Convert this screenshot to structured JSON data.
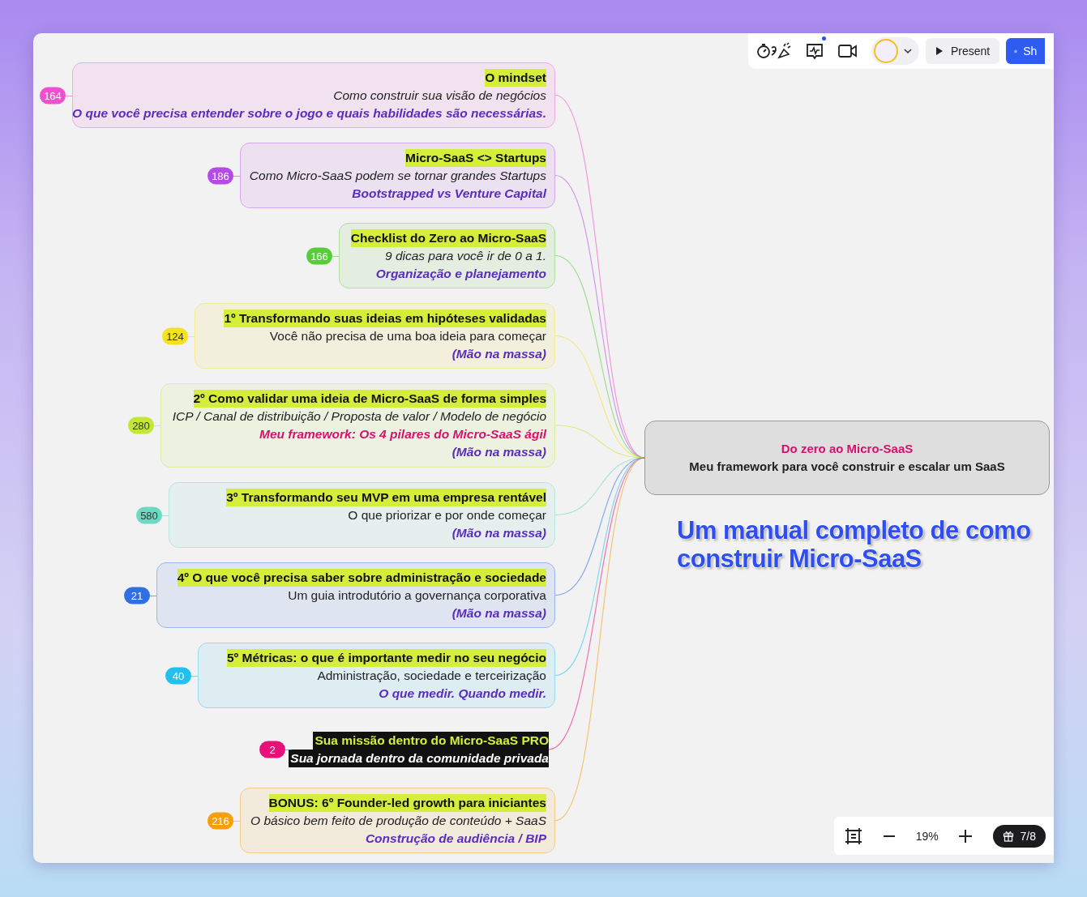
{
  "toolbar": {
    "present_label": "Present",
    "share_label": "Sh",
    "notification_dot": true
  },
  "nodes": [
    {
      "kind": "card",
      "count": "164",
      "color": "#f14fd0",
      "lines": [
        {
          "kind": "title",
          "text": "O mindset"
        },
        {
          "kind": "italic",
          "text": "Como construir sua visão de negócios"
        },
        {
          "kind": "note",
          "text": "O que você precisa entender sobre o jogo e quais habilidades são necessárias."
        }
      ]
    },
    {
      "kind": "card",
      "count": "186",
      "color": "#b54ae6",
      "lines": [
        {
          "kind": "title",
          "text": "Micro-SaaS <> Startups"
        },
        {
          "kind": "italic",
          "text": "Como Micro-SaaS podem se tornar grandes Startups"
        },
        {
          "kind": "note",
          "text": "Bootstrapped vs Venture Capital"
        }
      ]
    },
    {
      "kind": "card",
      "count": "166",
      "color": "#57cc3a",
      "lines": [
        {
          "kind": "title",
          "text": "Checklist do Zero ao Micro-SaaS"
        },
        {
          "kind": "italic",
          "text": "9 dicas para você ir de 0 a 1."
        },
        {
          "kind": "note",
          "text": "Organização e planejamento"
        }
      ]
    },
    {
      "kind": "card",
      "count": "124",
      "color": "#f4e21c",
      "lines": [
        {
          "kind": "title",
          "text": "1º Transformando suas ideias em hipóteses validadas"
        },
        {
          "kind": "plain",
          "text": "Você não precisa de uma boa ideia para começar"
        },
        {
          "kind": "note",
          "text": "(Mão na massa)"
        }
      ]
    },
    {
      "kind": "card",
      "count": "280",
      "color": "#c4e634",
      "lines": [
        {
          "kind": "title",
          "text": "2º Como validar uma ideia de Micro-SaaS de forma simples"
        },
        {
          "kind": "italic",
          "text": "ICP / Canal de distribuição / Proposta de valor / Modelo de negócio"
        },
        {
          "kind": "framework",
          "text": "Meu framework: Os 4 pilares do Micro-SaaS ágil"
        },
        {
          "kind": "note",
          "text": "(Mão na massa)"
        }
      ]
    },
    {
      "kind": "card",
      "count": "580",
      "color": "#6fd8c2",
      "lines": [
        {
          "kind": "title",
          "text": "3º Transformando seu MVP em uma empresa rentável"
        },
        {
          "kind": "plain",
          "text": "O que priorizar e por onde começar"
        },
        {
          "kind": "note",
          "text": "(Mão na massa)"
        }
      ]
    },
    {
      "kind": "card",
      "count": "21",
      "color": "#2f6fe2",
      "lines": [
        {
          "kind": "title",
          "text": "4º O que você precisa saber sobre administração e sociedade"
        },
        {
          "kind": "plain",
          "text": "Um guia introdutório a governança corporativa"
        },
        {
          "kind": "note",
          "text": "(Mão na massa)"
        }
      ]
    },
    {
      "kind": "card",
      "count": "40",
      "color": "#22c0ee",
      "lines": [
        {
          "kind": "title",
          "text": "5º Métricas: o que é importante medir no seu negócio"
        },
        {
          "kind": "plain",
          "text": "Administração, sociedade e terceirização"
        },
        {
          "kind": "note",
          "text": "O que medir. Quando medir."
        }
      ]
    },
    {
      "kind": "dark",
      "count": "2",
      "color": "#e8117a",
      "lines": [
        {
          "kind": "dark-title",
          "text": "Sua missão dentro do Micro-SaaS PRO"
        },
        {
          "kind": "dark-subtitle",
          "text": "Sua jornada dentro da comunidade privada"
        }
      ]
    },
    {
      "kind": "card",
      "count": "216",
      "color": "#f59f0b",
      "lines": [
        {
          "kind": "title",
          "text": "BONUS: 6º Founder-led growth para iniciantes"
        },
        {
          "kind": "italic",
          "text": "O básico bem feito de produção de conteúdo + SaaS"
        },
        {
          "kind": "note",
          "text": "Construção de audiência / BIP"
        }
      ]
    }
  ],
  "root": {
    "title": "Do zero ao Micro-SaaS",
    "subtitle": "Meu framework para você construir e escalar um SaaS"
  },
  "caption": "Um manual completo de como construir Micro-SaaS",
  "zoom_bar": {
    "zoom": "19%",
    "slides": "7/8"
  }
}
